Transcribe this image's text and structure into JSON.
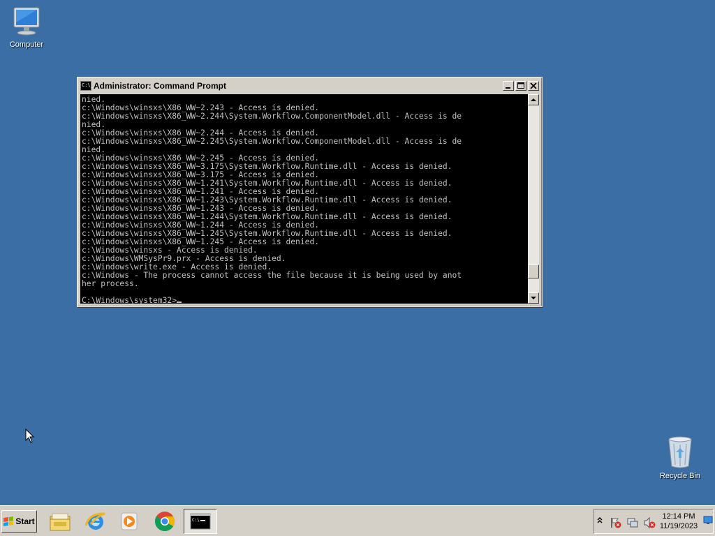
{
  "desktop": {
    "icons": [
      {
        "label": "Computer",
        "icon": "computer-icon"
      },
      {
        "label": "Recycle Bin",
        "icon": "recycle-bin-icon"
      }
    ]
  },
  "window": {
    "title": "Administrator: Command Prompt",
    "title_icon_text": "C:\\_",
    "buttons": {
      "minimize": "_",
      "maximize": "□",
      "close": "✕"
    },
    "lines": [
      "nied.",
      "c:\\Windows\\winsxs\\X86_WW~2.243 - Access is denied.",
      "c:\\Windows\\winsxs\\X86_WW~2.244\\System.Workflow.ComponentModel.dll - Access is de",
      "nied.",
      "c:\\Windows\\winsxs\\X86_WW~2.244 - Access is denied.",
      "c:\\Windows\\winsxs\\X86_WW~2.245\\System.Workflow.ComponentModel.dll - Access is de",
      "nied.",
      "c:\\Windows\\winsxs\\X86_WW~2.245 - Access is denied.",
      "c:\\Windows\\winsxs\\X86_WW~3.175\\System.Workflow.Runtime.dll - Access is denied.",
      "c:\\Windows\\winsxs\\X86_WW~3.175 - Access is denied.",
      "c:\\Windows\\winsxs\\X86_WW~1.241\\System.Workflow.Runtime.dll - Access is denied.",
      "c:\\Windows\\winsxs\\X86_WW~1.241 - Access is denied.",
      "c:\\Windows\\winsxs\\X86_WW~1.243\\System.Workflow.Runtime.dll - Access is denied.",
      "c:\\Windows\\winsxs\\X86_WW~1.243 - Access is denied.",
      "c:\\Windows\\winsxs\\X86_WW~1.244\\System.Workflow.Runtime.dll - Access is denied.",
      "c:\\Windows\\winsxs\\X86_WW~1.244 - Access is denied.",
      "c:\\Windows\\winsxs\\X86_WW~1.245\\System.Workflow.Runtime.dll - Access is denied.",
      "c:\\Windows\\winsxs\\X86_WW~1.245 - Access is denied.",
      "c:\\Windows\\winsxs - Access is denied.",
      "c:\\Windows\\WMSysPr9.prx - Access is denied.",
      "c:\\Windows\\write.exe - Access is denied.",
      "c:\\Windows - The process cannot access the file because it is being used by anot",
      "her process."
    ],
    "prompt": "C:\\Windows\\system32>",
    "scroll_position": 0.92
  },
  "taskbar": {
    "start_label": "Start",
    "items": [
      {
        "name": "windows-explorer",
        "icon": "folder-icon"
      },
      {
        "name": "internet-explorer",
        "icon": "internet-explorer-icon"
      },
      {
        "name": "windows-media-player",
        "icon": "media-player-icon"
      },
      {
        "name": "google-chrome",
        "icon": "chrome-icon"
      },
      {
        "name": "command-prompt",
        "icon": "command-prompt-icon",
        "active": true
      }
    ],
    "tray": {
      "time": "12:14 PM",
      "date": "11/19/2023",
      "icons": [
        "show-hidden-icons-icon",
        "action-center-icon",
        "network-icon",
        "volume-muted-icon"
      ]
    }
  },
  "colors": {
    "desktop": "#3a6ea5",
    "console_bg": "#000000",
    "console_text": "#c0c0c0",
    "chrome_face": "#d4d0c8"
  }
}
